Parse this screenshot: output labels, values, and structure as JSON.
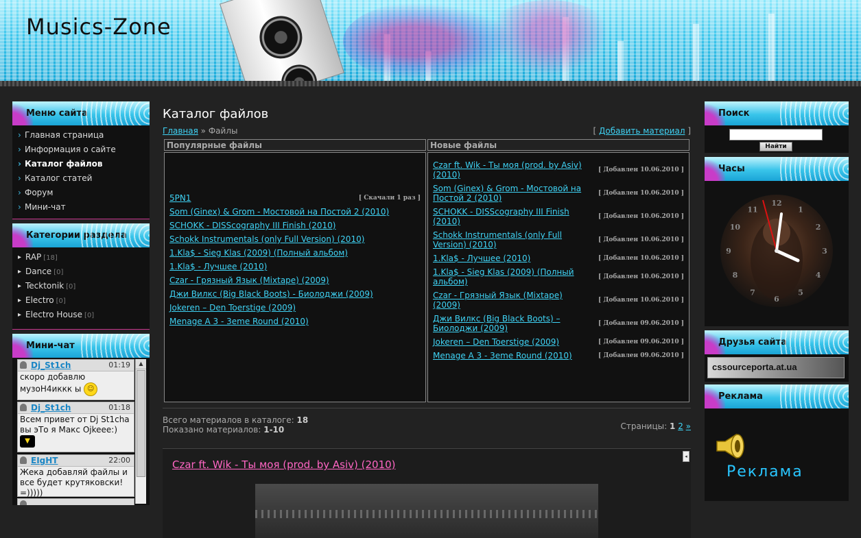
{
  "site": {
    "title": "Musics-Zone"
  },
  "left": {
    "menu": {
      "title": "Меню сайта",
      "items": [
        {
          "label": "Главная страница",
          "active": false
        },
        {
          "label": "Информация о сайте",
          "active": false
        },
        {
          "label": "Каталог файлов",
          "active": true
        },
        {
          "label": "Каталог статей",
          "active": false
        },
        {
          "label": "Форум",
          "active": false
        },
        {
          "label": "Мини-чат",
          "active": false
        }
      ]
    },
    "categories": {
      "title": "Категории раздела",
      "items": [
        {
          "label": "RAP",
          "count": "[18]"
        },
        {
          "label": "Dance",
          "count": "[0]"
        },
        {
          "label": "Tecktonik",
          "count": "[0]"
        },
        {
          "label": "Electro",
          "count": "[0]"
        },
        {
          "label": "Electro House",
          "count": "[0]"
        }
      ]
    },
    "chat": {
      "title": "Мини-чат",
      "messages": [
        {
          "nick": "Dj_St1ch",
          "time": "01:19",
          "text": "скоро добавлю музоН4иккк ы"
        },
        {
          "nick": "Dj_St1ch",
          "time": "01:18",
          "text": "Всем привет от Dj St1cha вы эТо я Макс Ojkeee:)"
        },
        {
          "nick": "EIgHT",
          "time": "22:00",
          "text": "Жека добавляй файлы и все будет крутяковски! =)))))"
        }
      ]
    }
  },
  "main": {
    "title": "Каталог файлов",
    "breadcrumb": {
      "home": "Главная",
      "sep": "»",
      "current": "Файлы"
    },
    "add_material": {
      "open": "[",
      "label": "Добавить материал",
      "close": "]"
    },
    "popular": {
      "header": "Популярные файлы",
      "first_meta": "[ Скачали 1 раз ]",
      "items": [
        "5PN1",
        "Som (Ginex) & Grom - Мостовой на Постой 2 (2010)",
        "SCHOKK - DISScography III Finish (2010)",
        "Schokk Instrumentals (only Full Version) (2010)",
        "1.Kla$ - Sieg Klas (2009) (Полный альбом)",
        "1.Kla$ - Лучшее (2010)",
        "Czar - Грязный Язык (Mixtape) (2009)",
        "Джи Вилкс (Big Black Boots) - Биолоджи (2009)",
        "Jokeren – Den Toerstige (2009)",
        "Menage A 3 - 3eme Round (2010)"
      ]
    },
    "new": {
      "header": "Новые файлы",
      "items": [
        {
          "name": "Czar ft. Wik - Ты моя (prod. by Asiv) (2010)",
          "date": "[ Добавлен 10.06.2010 ]"
        },
        {
          "name": "Som (Ginex) & Grom - Мостовой на Постой 2 (2010)",
          "date": "[ Добавлен 10.06.2010 ]"
        },
        {
          "name": "SCHOKK - DISScography III Finish (2010)",
          "date": "[ Добавлен 10.06.2010 ]"
        },
        {
          "name": "Schokk Instrumentals (only Full Version) (2010)",
          "date": "[ Добавлен 10.06.2010 ]"
        },
        {
          "name": "1.Kla$ - Лучшее (2010)",
          "date": "[ Добавлен 10.06.2010 ]"
        },
        {
          "name": "1.Kla$ - Sieg Klas (2009) (Полный альбом)",
          "date": "[ Добавлен 10.06.2010 ]"
        },
        {
          "name": "Czar - Грязный Язык (Mixtape) (2009)",
          "date": "[ Добавлен 10.06.2010 ]"
        },
        {
          "name": "Джи Вилкс (Big Black Boots) – Биолоджи (2009)",
          "date": "[ Добавлен 09.06.2010 ]"
        },
        {
          "name": "Jokeren – Den Toerstige (2009)",
          "date": "[ Добавлен 09.06.2010 ]"
        },
        {
          "name": "Menage A 3 - 3eme Round (2010)",
          "date": "[ Добавлен 09.06.2010 ]"
        }
      ]
    },
    "stats": {
      "total_label": "Всего материалов в каталоге:",
      "total": "18",
      "shown_label": "Показано материалов:",
      "shown": "1-10"
    },
    "pages": {
      "label": "Страницы:",
      "current": "1",
      "next_page": "2",
      "next": "»"
    },
    "entry": {
      "title": "Czar ft. Wik - Ты моя (prod. by Asiv) (2010)"
    }
  },
  "right": {
    "search": {
      "title": "Поиск",
      "button": "Найти"
    },
    "clock": {
      "title": "Часы",
      "numbers": [
        "12",
        "1",
        "2",
        "3",
        "4",
        "5",
        "6",
        "7",
        "8",
        "9",
        "10",
        "11"
      ]
    },
    "friends": {
      "title": "Друзья сайта",
      "banner": "cssourceporta.at.ua"
    },
    "ad": {
      "title": "Реклама",
      "text": "Реклама"
    }
  },
  "colors": {
    "accent": "#3fd3f5",
    "pink": "#ff66c4",
    "header": "#3cc6ec"
  }
}
